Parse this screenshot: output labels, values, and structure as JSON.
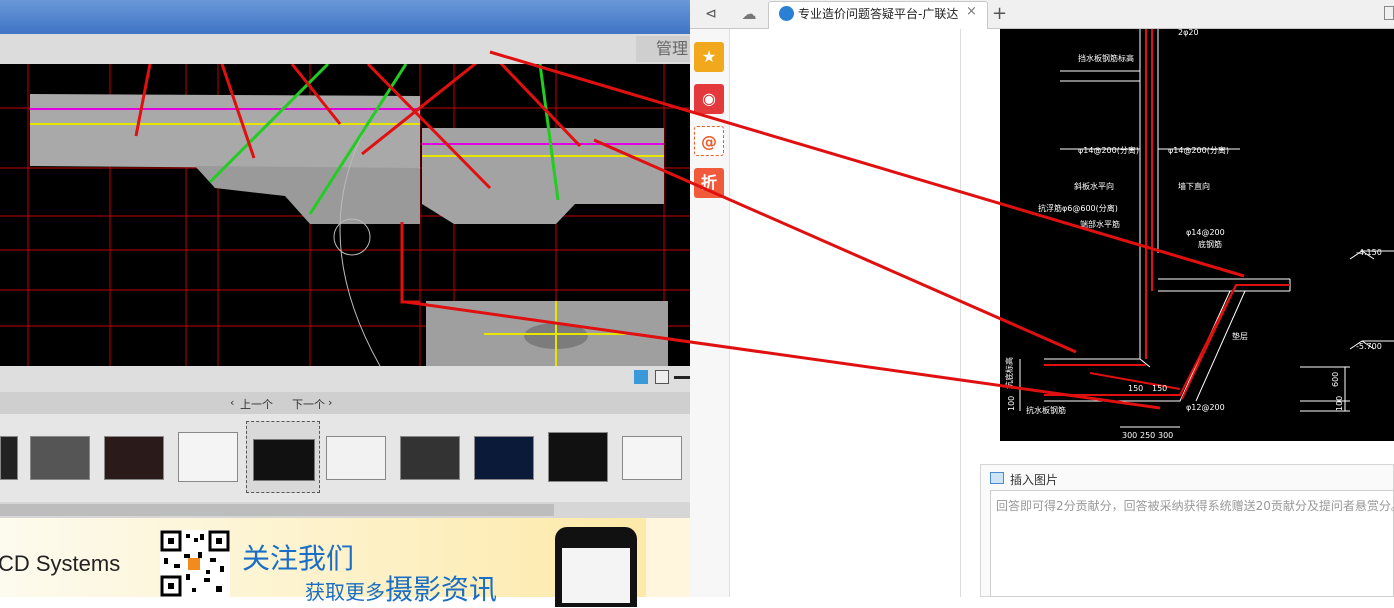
{
  "left_window": {
    "manage_button": "管理",
    "nav": {
      "prev": "上一个",
      "next": "下一个"
    },
    "banner": {
      "company": "CD Systems",
      "follow": "关注我们",
      "more_prefix": "获取更多",
      "more_big": "摄影资讯"
    }
  },
  "browser": {
    "active_tab_title": "专业造价问题答疑平台-广联达",
    "share_icons": [
      {
        "name": "favorite-icon",
        "glyph": "★",
        "color": "#f2a81d"
      },
      {
        "name": "weibo-icon",
        "glyph": "◉",
        "color": "#e4393c"
      },
      {
        "name": "email-icon",
        "glyph": "@",
        "color": "#e85d2a"
      },
      {
        "name": "discount-icon",
        "glyph": "折",
        "color": "#f05a3a"
      }
    ],
    "insert_image_label": "插入图片",
    "answer_placeholder": "回答即可得2分贡献分，回答被采纳获得系统赠送20贡献分及提问者悬赏分。"
  },
  "cad_labels": {
    "top_dim": "2φ20",
    "l1": "挡水板钢筋标高",
    "l2": "φ14@200(分离)",
    "l3": "φ14@200(分离)",
    "l4": "斜板水平向",
    "l5": "墙下直向",
    "l6": "抗浮筋φ6@600(分离)",
    "l7": "端部水平筋",
    "l8": "φ14@200",
    "l9": "底钢筋",
    "l10": "-4.150",
    "l11": "垫层",
    "l12": "-5.700",
    "l13": "150",
    "l14": "150",
    "l15": "φ12@200",
    "l16": "600",
    "l17": "100",
    "l18": "100",
    "l19": "抗水板钢筋",
    "l20": "300",
    "l21": "250",
    "l22": "300",
    "l23": "坑底标高"
  }
}
